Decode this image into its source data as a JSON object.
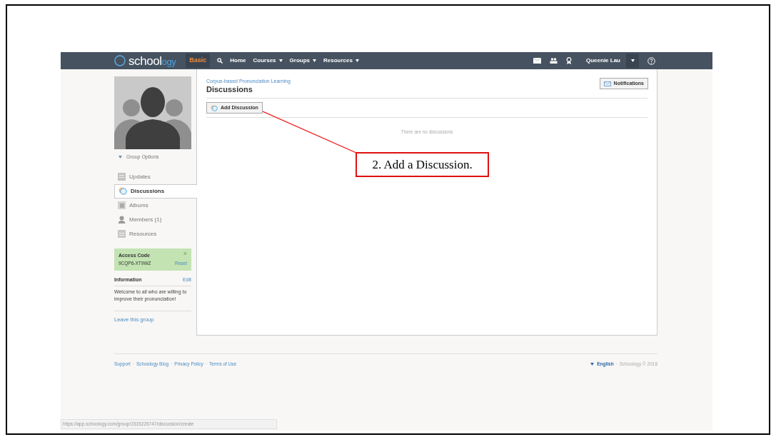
{
  "navbar": {
    "logo_parts": [
      "school",
      "ogy"
    ],
    "items": [
      {
        "label": "Basic",
        "kind": "badge"
      },
      {
        "kind": "search"
      },
      {
        "label": "Home",
        "kind": "link",
        "dropdown": false
      },
      {
        "label": "Courses",
        "kind": "link",
        "dropdown": true
      },
      {
        "label": "Groups",
        "kind": "link",
        "dropdown": true
      },
      {
        "label": "Resources",
        "kind": "link",
        "dropdown": true
      }
    ],
    "user": "Queenie Lau"
  },
  "sidebar": {
    "group_options": "Group Options",
    "items": [
      {
        "label": "Updates",
        "kind": "updates",
        "selected": false
      },
      {
        "label": "Discussions",
        "kind": "discussions",
        "selected": true
      },
      {
        "label": "Albums",
        "kind": "albums",
        "selected": false
      },
      {
        "label": "Members (1)",
        "kind": "members",
        "selected": false
      },
      {
        "label": "Resources",
        "kind": "resources",
        "selected": false
      }
    ],
    "access_code": {
      "title": "Access Code",
      "code": "9CQP6-XT9WZ",
      "reset": "Reset",
      "close": "×"
    },
    "information": {
      "title": "Information",
      "edit": "Edit",
      "text": "Welcome to all who are willing to improve their pronunciation!"
    },
    "leave": "Leave this group"
  },
  "main": {
    "breadcrumb": "Corpus-based Pronunciation Learning",
    "title": "Discussions",
    "notifications": "Notifications",
    "add_button": "Add Discussion",
    "empty": "There are no discussions"
  },
  "footer": {
    "links": [
      "Support",
      "Schoology Blog",
      "Privacy Policy",
      "Terms of Use"
    ],
    "separator": "·",
    "language": "English",
    "copyright": "Schoology © 2018"
  },
  "status_url": "https://app.schoology.com/group/1515226747/discussion/create",
  "callout": "2. Add a Discussion."
}
